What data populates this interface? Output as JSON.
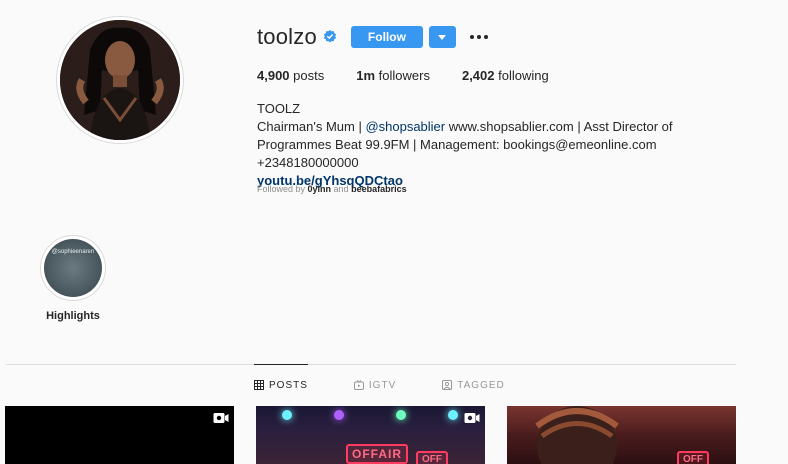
{
  "profile": {
    "username": "toolzo",
    "follow_label": "Follow",
    "posts_count": "4,900",
    "posts_label": "posts",
    "followers_count": "1m",
    "followers_label": "followers",
    "following_count": "2,402",
    "following_label": "following",
    "full_name": "TOOLZ",
    "bio_prefix": "Chairman's Mum | ",
    "bio_mention": "@shopsablier",
    "bio_suffix": " www.shopsablier.com | Asst Director of Programmes Beat 99.9FM | Management: bookings@emeonline.com +2348180000000",
    "link": "youtu.be/gYhsqQDCtao",
    "followed_by_prefix": "Followed by ",
    "followed_by_user1": "0yinn",
    "followed_by_and": " and ",
    "followed_by_user2": "beebafabrics"
  },
  "highlights": [
    {
      "label": "Highlights",
      "cover_text": "@sophieenaren"
    }
  ],
  "tabs": [
    {
      "label": "POSTS",
      "icon": "grid-icon",
      "active": true
    },
    {
      "label": "IGTV",
      "icon": "igtv-icon",
      "active": false
    },
    {
      "label": "TAGGED",
      "icon": "tagged-icon",
      "active": false
    }
  ],
  "posts": [
    {
      "type": "video"
    },
    {
      "type": "video",
      "sign_text": "OFFAIR",
      "sign_text_2": "OFF"
    },
    {
      "type": "image",
      "sign_text": "OFF"
    }
  ],
  "colors": {
    "accent": "#3897f0",
    "link": "#003569",
    "muted": "#8e8e8e",
    "background": "#fafafa"
  }
}
